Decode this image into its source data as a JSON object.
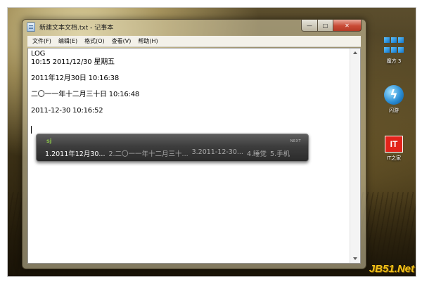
{
  "window": {
    "title": "新建文本文档.txt - 记事本",
    "controls": {
      "minimize": "—",
      "maximize": "□",
      "close": "✕"
    }
  },
  "menu": [
    {
      "label": "文件(F)"
    },
    {
      "label": "编辑(E)"
    },
    {
      "label": "格式(O)"
    },
    {
      "label": "查看(V)"
    },
    {
      "label": "帮助(H)"
    }
  ],
  "document": {
    "lines": [
      "LOG",
      "10:15 2011/12/30 星期五",
      "2011年12月30日 10:16:38",
      "二〇一一年十二月三十日 10:16:48",
      "2011-12-30 10:16:52"
    ]
  },
  "ime": {
    "logo": "sj",
    "next_label": "NEXT",
    "candidates": [
      "1.2011年12月30...",
      "2.二〇一一年十二月三十...",
      "3.2011-12-30...",
      "4.睡觉",
      "5.手机"
    ]
  },
  "desktop_icons": [
    {
      "label": "魔方 3"
    },
    {
      "label": "闪游"
    },
    {
      "label": "IT之家",
      "badge": "IT"
    }
  ],
  "watermark": "JB51.Net"
}
